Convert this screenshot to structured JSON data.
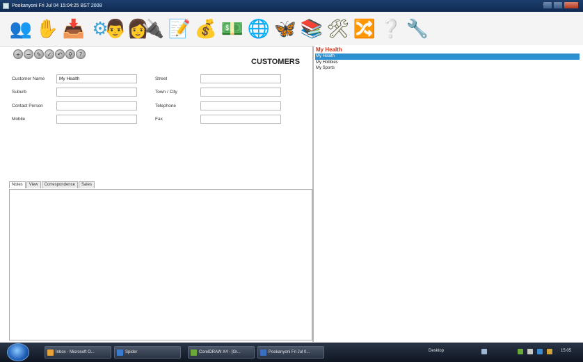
{
  "window": {
    "title": "Pookanyoni Fri Jul 04 15:04:25 BST 2008"
  },
  "toolbar": {
    "icons": [
      "users-icon",
      "hand-icon",
      "arrow-box-icon",
      "gear-icon",
      "people-icon",
      "plug-icon",
      "edit-icon",
      "money-person-icon",
      "money-bag-icon",
      "globe-icon",
      "butterfly-icon",
      "books-icon",
      "tools-icon",
      "network-icon",
      "help-icon",
      "wrench-icon"
    ],
    "glyphs": [
      "👥",
      "✋",
      "📥",
      "⚙",
      "👨‍👩",
      "🔌",
      "📝",
      "💰",
      "💵",
      "🌐",
      "🦋",
      "📚",
      "🛠",
      "🔀",
      "❔",
      "🔧"
    ],
    "colors": [
      "#c8461e",
      "#d87a2a",
      "#7a9b2a",
      "#3aa2d4",
      "#5a8a2a",
      "#c89a2a",
      "#2f6bb8",
      "#3f9a3a",
      "#2f8a3a",
      "#3a6fc0",
      "#7a3ab0",
      "#3a5a9a",
      "#6a6a4a",
      "#5a8a5a",
      "#4a6a9a",
      "#2a6ab0"
    ]
  },
  "form": {
    "heading": "CUSTOMERS",
    "fields": [
      {
        "label": "Customer Name",
        "value": "My Health"
      },
      {
        "label": "Suburb",
        "value": ""
      },
      {
        "label": "Contact Person",
        "value": ""
      },
      {
        "label": "Mobile",
        "value": ""
      },
      {
        "label": "Street",
        "value": ""
      },
      {
        "label": "Town / City",
        "value": ""
      },
      {
        "label": "Telephone",
        "value": ""
      },
      {
        "label": "Fax",
        "value": ""
      }
    ],
    "tabs": [
      "Notes",
      "View",
      "Correspondence",
      "Sales"
    ]
  },
  "list": {
    "title": "My Health",
    "items": [
      "My Health",
      "My Hobbies",
      "My Sports"
    ],
    "selected": 0,
    "selection_color": "#2b8fd0",
    "title_color": "#c83218"
  },
  "taskbar": {
    "tasks": [
      "Inbox - Microsoft O...",
      "Spider",
      "CorelDRAW X4 - [Gr...",
      "Pookanyoni Fri Jul 0..."
    ],
    "task_colors": [
      "#e8a23a",
      "#3a7bd0",
      "#6aa83a",
      "#3a6fc0"
    ],
    "desktop_label": "Desktop",
    "clock": "15:05"
  }
}
